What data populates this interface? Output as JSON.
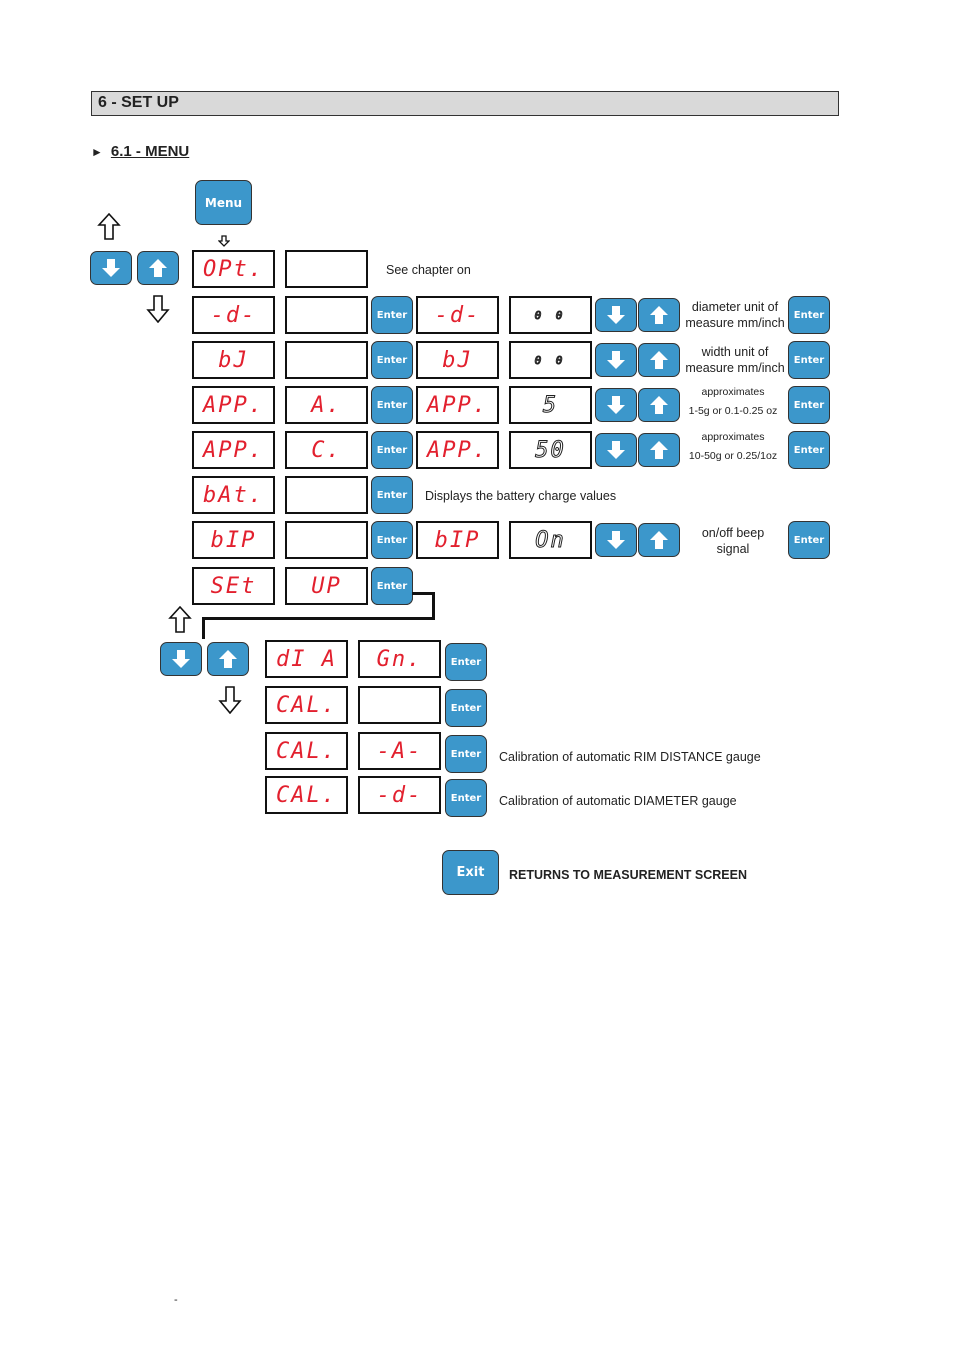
{
  "section": {
    "number_title": "6 - SET UP"
  },
  "subsection": {
    "marker": "►",
    "title": "6.1 - MENU"
  },
  "menu_button": {
    "label": "Menu"
  },
  "enter_label": "Enter",
  "exit_button": {
    "label": "Exit",
    "description": "RETURNS TO MEASUREMENT SCREEN"
  },
  "menu_rows": [
    {
      "display1": "OPt.",
      "display2": "",
      "note": "See chapter on"
    },
    {
      "display1": "-d-",
      "display2": "",
      "display3": "-d-",
      "value": "0 0",
      "note": "diameter unit of measure mm/inch"
    },
    {
      "display1": "bJ",
      "display2": "",
      "display3": "bJ",
      "value": "0 0",
      "note": "width unit of measure mm/inch"
    },
    {
      "display1": "APP.",
      "display2": "A.",
      "display3": "APP.",
      "value": "5",
      "note_line1": "approximates",
      "note_line2": "1-5g or 0.1-0.25 oz"
    },
    {
      "display1": "APP.",
      "display2": "C.",
      "display3": "APP.",
      "value": "50",
      "note_line1": "approximates",
      "note_line2": "10-50g or 0.25/1oz"
    },
    {
      "display1": "bAt.",
      "display2": "",
      "note": "Displays the battery charge values"
    },
    {
      "display1": "bIP",
      "display2": "",
      "display3": "bIP",
      "value": "On",
      "note_line1": "on/off beep",
      "note_line2": "signal"
    },
    {
      "display1": "SEt",
      "display2": "UP"
    }
  ],
  "setup_rows": [
    {
      "display1": "dI A",
      "display2": "Gn."
    },
    {
      "display1": "CAL.",
      "display2": ""
    },
    {
      "display1": "CAL.",
      "display2": "-A-",
      "note": "Calibration of automatic RIM DISTANCE gauge"
    },
    {
      "display1": "CAL.",
      "display2": "-d-",
      "note": "Calibration of automatic DIAMETER gauge"
    }
  ],
  "footer": {
    "page_mark": "-"
  }
}
